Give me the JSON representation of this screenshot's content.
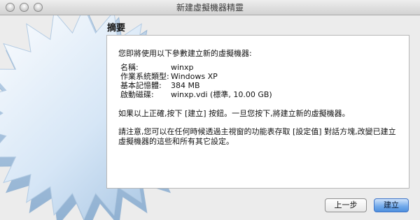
{
  "window": {
    "title": "新建虛擬機器精靈"
  },
  "dialog": {
    "heading": "摘要",
    "intro": "您即將使用以下參數建立新的虛擬機器:",
    "summary": [
      {
        "label": "名稱:",
        "value": "winxp"
      },
      {
        "label": "作業系統類型:",
        "value": "Windows XP"
      },
      {
        "label": "基本記憶體:",
        "value": "384 MB"
      },
      {
        "label": "啟動磁碟:",
        "value": "winxp.vdi (標準, 10.00 GB)"
      }
    ],
    "instruction": "如果以上正確,按下 [建立] 按鈕。一旦您按下,將建立新的虛擬機器。",
    "note": "請注意,您可以在任何時候透過主視窗的功能表存取 [設定值] 對話方塊,改變已建立虛擬機器的這些和所有其它設定。"
  },
  "buttons": {
    "back": "上一步",
    "create": "建立"
  },
  "colors": {
    "window_bg": "#ececec",
    "panel_bg": "#ffffff",
    "default_button": "#6fa8ea"
  }
}
